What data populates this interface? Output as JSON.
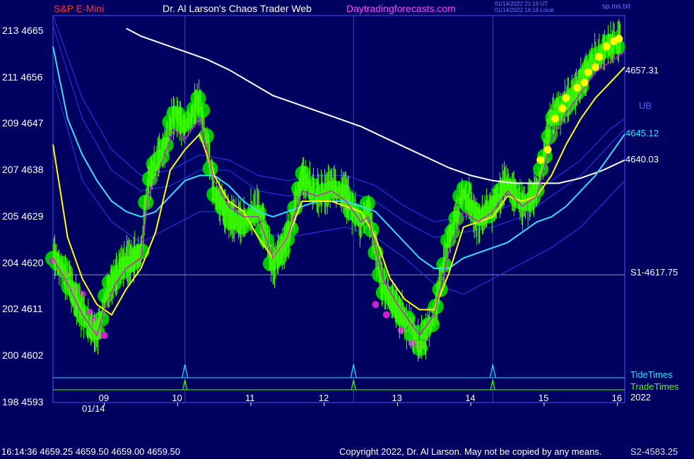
{
  "header": {
    "symbol": "S&P E-Mini",
    "title": "Dr. Al Larson's Chaos Trader Web",
    "site": "Daytradingforecasts.com",
    "ts_utc": "01/14/2022 21:16 UT",
    "ts_local": "01/14/2022 16:16 Local",
    "file": "sp.ms.txt"
  },
  "footer": {
    "quote": "16:14:36  4659.25 4659.50 4659.00 4659.50",
    "copyright": "Copyright 2022, Dr. Al Larson. May not be copied by any means.",
    "s2": "S2-4583.25"
  },
  "labels": {
    "ub": "UB",
    "tide_times": "TideTimes",
    "trade_times": "TradeTimes",
    "year": "2022",
    "date": "01/14"
  },
  "colors": {
    "background": "#000060",
    "frame": "#4455ff",
    "price_bars": "#44ff00",
    "green_dots": "#00c800",
    "yellow_line": "#ffff00",
    "cyan_line": "#33e0ff",
    "white_line": "#ffffff",
    "magenta": "#cc22cc",
    "symbol_red": "#ff3030",
    "site_magenta": "#ff44ff"
  },
  "chart_data": {
    "type": "line",
    "title": "S&P E-Mini",
    "x_ticks": [
      "09",
      "10",
      "11",
      "12",
      "13",
      "14",
      "15",
      "16"
    ],
    "xlim": [
      8.3,
      16.1
    ],
    "y_ticks": [
      {
        "left": "213",
        "price": 4665
      },
      {
        "left": "211",
        "price": 4656
      },
      {
        "left": "209",
        "price": 4647
      },
      {
        "left": "207",
        "price": 4638
      },
      {
        "left": "205",
        "price": 4629
      },
      {
        "left": "204",
        "price": 4620
      },
      {
        "left": "202",
        "price": 4611
      },
      {
        "left": "200",
        "price": 4602
      },
      {
        "left": "198",
        "price": 4593
      }
    ],
    "ylim": [
      4593,
      4668
    ],
    "support_line": {
      "label": "S1-4617.75",
      "value": 4617.75
    },
    "right_labels": [
      {
        "text": "4657.31",
        "value": 4657.31,
        "color": "#ffffff"
      },
      {
        "text": "4645.12",
        "value": 4645.12,
        "color": "#33e0ff"
      },
      {
        "text": "4640.03",
        "value": 4640.03,
        "color": "#ffffff"
      }
    ],
    "tide_times": [
      10.1,
      12.4,
      14.3
    ],
    "series": [
      {
        "key": "price",
        "color": "#44ff00",
        "x": [
          8.3,
          8.5,
          8.7,
          8.9,
          9.0,
          9.15,
          9.3,
          9.5,
          9.6,
          9.8,
          9.95,
          10.1,
          10.3,
          10.5,
          10.7,
          10.9,
          11.1,
          11.3,
          11.5,
          11.7,
          11.9,
          12.1,
          12.3,
          12.5,
          12.6,
          12.8,
          13.0,
          13.2,
          13.3,
          13.5,
          13.7,
          13.9,
          14.1,
          14.3,
          14.5,
          14.7,
          14.9,
          15.1,
          15.3,
          15.5,
          15.7,
          15.9,
          16.1
        ],
        "y": [
          4622,
          4617,
          4610,
          4605.5,
          4613,
          4618,
          4620,
          4622,
          4636,
          4642,
          4649,
          4646,
          4652,
          4634,
          4629,
          4628,
          4631,
          4619,
          4625,
          4637,
          4633,
          4635,
          4633,
          4627,
          4631,
          4615,
          4611,
          4607,
          4604,
          4610,
          4625,
          4634,
          4628,
          4631,
          4636,
          4631,
          4634,
          4648,
          4651,
          4655,
          4660,
          4662,
          4664
        ]
      },
      {
        "key": "magenta_line",
        "color": "#cc22cc",
        "x": [
          8.3,
          8.5,
          8.7,
          8.9,
          9.0,
          9.15,
          9.3,
          9.5,
          9.6,
          9.8,
          9.95,
          10.1,
          10.3,
          10.5,
          10.7,
          10.9,
          11.1,
          11.3,
          11.5,
          11.7,
          11.9,
          12.1,
          12.3,
          12.5,
          12.6,
          12.8,
          13.0,
          13.2,
          13.3,
          13.5,
          13.7,
          13.9,
          14.1,
          14.3,
          14.5,
          14.7,
          14.9,
          15.1,
          15.3,
          15.5,
          15.7,
          15.9,
          16.1
        ],
        "y": [
          4621,
          4616,
          4610,
          4606,
          4611,
          4616,
          4619,
          4621,
          4633,
          4640,
          4646,
          4644,
          4648,
          4636,
          4631,
          4629,
          4629,
          4621,
          4625,
          4634,
          4633,
          4634,
          4632,
          4628,
          4629,
          4617,
          4612,
          4608,
          4606,
          4610,
          4622,
          4630,
          4628,
          4630,
          4634,
          4631,
          4633,
          4644,
          4649,
          4653,
          4657,
          4659,
          4661
        ]
      },
      {
        "key": "yellow_line",
        "color": "#ffff00",
        "x": [
          8.3,
          8.5,
          8.7,
          8.9,
          9.1,
          9.3,
          9.5,
          9.7,
          9.9,
          10.1,
          10.3,
          10.5,
          10.7,
          10.9,
          11.1,
          11.3,
          11.5,
          11.7,
          11.9,
          12.1,
          12.3,
          12.5,
          12.7,
          12.9,
          13.1,
          13.3,
          13.5,
          13.7,
          13.9,
          14.1,
          14.3,
          14.5,
          14.7,
          14.9,
          15.1,
          15.3,
          15.5,
          15.7,
          15.9,
          16.1
        ],
        "y": [
          4643,
          4625,
          4617,
          4612,
          4610,
          4615,
          4619,
          4626,
          4638,
          4642,
          4645,
          4637,
          4632,
          4630,
          4625,
          4621,
          4625,
          4632,
          4632,
          4632,
          4631,
          4630,
          4625,
          4617,
          4613,
          4611,
          4611,
          4618,
          4627,
          4628,
          4629,
          4633,
          4632,
          4633,
          4637,
          4643,
          4648,
          4652,
          4655,
          4658
        ]
      },
      {
        "key": "cyan_line",
        "color": "#33e0ff",
        "x": [
          8.3,
          8.5,
          8.7,
          8.9,
          9.1,
          9.3,
          9.5,
          9.7,
          9.9,
          10.1,
          10.3,
          10.5,
          10.7,
          10.9,
          11.1,
          11.3,
          11.5,
          11.7,
          11.9,
          12.1,
          12.3,
          12.5,
          12.7,
          12.9,
          13.1,
          13.3,
          13.5,
          13.7,
          13.9,
          14.1,
          14.3,
          14.5,
          14.7,
          14.9,
          15.1,
          15.3,
          15.5,
          15.7,
          15.9,
          16.1
        ],
        "y": [
          4662,
          4648,
          4641,
          4636,
          4632,
          4630,
          4629,
          4630,
          4633,
          4636,
          4637,
          4637,
          4635,
          4632,
          4630,
          4629,
          4630,
          4631,
          4632,
          4632,
          4632,
          4631,
          4630,
          4627,
          4624,
          4621,
          4619,
          4619,
          4621,
          4622,
          4623,
          4624,
          4626,
          4628,
          4629,
          4631,
          4634,
          4637,
          4641,
          4645
        ]
      },
      {
        "key": "upper_band",
        "color": "#2233dd",
        "x": [
          8.3,
          8.7,
          9.1,
          9.5,
          9.9,
          10.3,
          10.7,
          11.1,
          11.5,
          11.9,
          12.3,
          12.7,
          13.1,
          13.5,
          13.9,
          14.3,
          14.7,
          15.1,
          15.5,
          15.9,
          16.1
        ],
        "y": [
          4668,
          4652,
          4642,
          4637,
          4638,
          4641,
          4640,
          4637,
          4636,
          4637,
          4637,
          4635,
          4631,
          4628,
          4629,
          4630,
          4632,
          4636,
          4640,
          4646,
          4648
        ]
      },
      {
        "key": "outer_upper_band",
        "color": "#2233dd",
        "x": [
          8.3,
          8.7,
          9.1,
          9.5,
          9.9,
          10.3,
          10.7,
          11.1,
          11.5,
          11.9,
          12.3,
          12.7,
          13.1,
          13.5,
          13.9,
          14.3,
          14.7,
          15.1,
          15.5,
          15.9,
          16.1
        ],
        "y": [
          4666,
          4648,
          4638,
          4634,
          4635,
          4638,
          4638,
          4634,
          4633,
          4634,
          4634,
          4632,
          4628,
          4625,
          4626,
          4627,
          4629,
          4633,
          4637,
          4643,
          4646
        ]
      },
      {
        "key": "lower_band",
        "color": "#2233dd",
        "x": [
          8.3,
          8.7,
          9.1,
          9.5,
          9.9,
          10.3,
          10.7,
          11.1,
          11.5,
          11.9,
          12.3,
          12.7,
          13.1,
          13.5,
          13.9,
          14.3,
          14.7,
          15.1,
          15.5,
          15.9,
          16.1
        ],
        "y": [
          4656,
          4636,
          4628,
          4624,
          4627,
          4630,
          4630,
          4626,
          4625,
          4626,
          4627,
          4625,
          4621,
          4616,
          4614,
          4617,
          4620,
          4623,
          4627,
          4633,
          4636
        ]
      },
      {
        "key": "white_line",
        "color": "#ffffff",
        "x": [
          9.3,
          9.5,
          9.8,
          10.1,
          10.4,
          10.7,
          11.0,
          11.3,
          11.6,
          11.9,
          12.2,
          12.5,
          12.8,
          13.1,
          13.4,
          13.7,
          14.0,
          14.3,
          14.6,
          14.9,
          15.2,
          15.5,
          15.8,
          16.1
        ],
        "y": [
          4665.5,
          4664,
          4662.5,
          4661,
          4659.5,
          4657.5,
          4655,
          4652.5,
          4651,
          4649.5,
          4648,
          4646.5,
          4644.5,
          4642.5,
          4640.5,
          4638.5,
          4637,
          4636,
          4635.5,
          4635.5,
          4635.5,
          4636.5,
          4638,
          4640
        ]
      }
    ]
  }
}
